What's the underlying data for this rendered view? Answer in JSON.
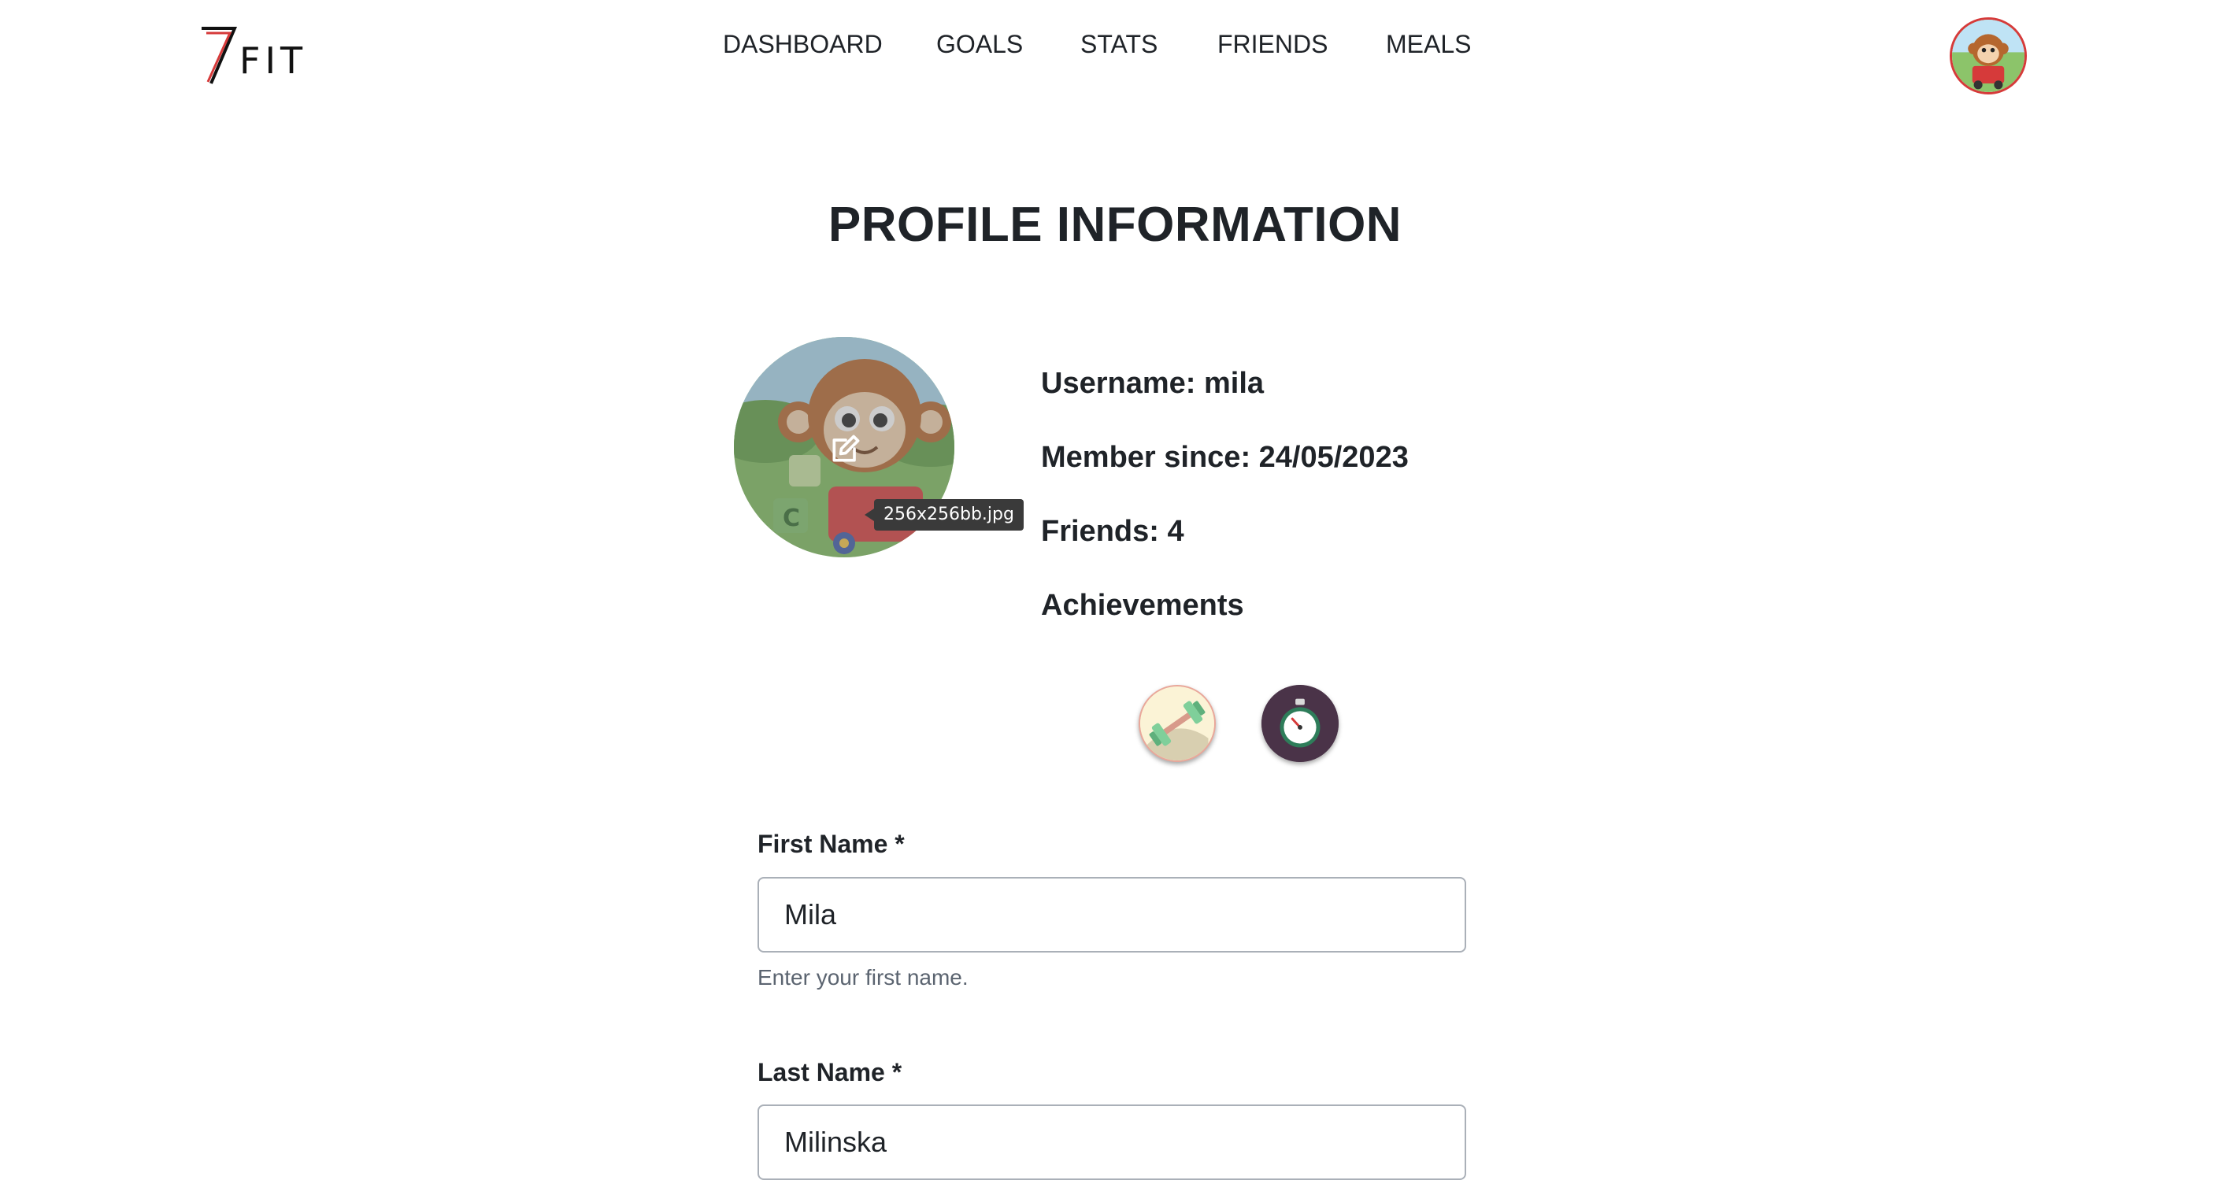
{
  "app": {
    "logo_digit": "7",
    "logo_text": "FIT"
  },
  "nav": {
    "items": [
      {
        "label": "DASHBOARD"
      },
      {
        "label": "GOALS"
      },
      {
        "label": "STATS"
      },
      {
        "label": "FRIENDS"
      },
      {
        "label": "MEALS"
      }
    ]
  },
  "page": {
    "title": "PROFILE INFORMATION"
  },
  "profile": {
    "picture_tooltip": "256x256bb.jpg",
    "username_line": "Username: mila",
    "member_since_line": "Member since: 24/05/2023",
    "friends_line": "Friends: 4",
    "achievements_heading": "Achievements",
    "achievements": [
      {
        "icon": "dumbbell-icon"
      },
      {
        "icon": "stopwatch-icon"
      }
    ]
  },
  "form": {
    "first_name": {
      "label": "First Name *",
      "value": "Mila",
      "help": "Enter your first name."
    },
    "last_name": {
      "label": "Last Name *",
      "value": "Milinska"
    }
  },
  "colors": {
    "text": "#1f2328",
    "accent_red": "#d63a3a",
    "badge_dark": "#4a3348",
    "badge_light": "#fbf3d6"
  }
}
